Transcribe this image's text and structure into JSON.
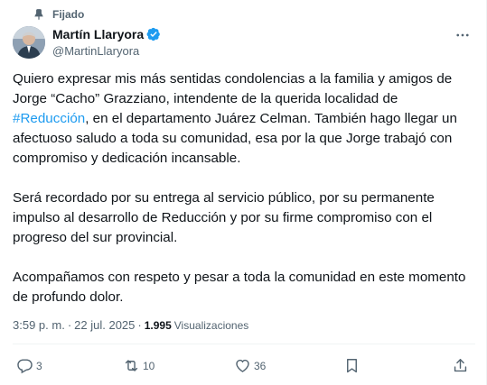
{
  "pinned": {
    "label": "Fijado"
  },
  "author": {
    "name": "Martín Llaryora",
    "handle": "@MartinLlaryora"
  },
  "post": {
    "p1_a": "Quiero expresar mis más sentidas condolencias a la familia y amigos de Jorge “Cacho” Grazziano, intendente de la querida localidad de ",
    "p1_hashtag": "#Reducción",
    "p1_b": ", en el departamento Juárez Celman. También hago llegar un afectuoso saludo a toda su comunidad, esa por la que Jorge trabajó con compromiso y dedicación incansable.",
    "p2": "Será recordado por su entrega al servicio público, por su permanente impulso al desarrollo de Reducción y por su firme compromiso con el progreso del sur provincial.",
    "p3": "Acompañamos con respeto y pesar a toda la comunidad en este momento de profundo dolor."
  },
  "meta": {
    "time": "3:59 p. m.",
    "separator": "·",
    "date": "22 jul. 2025",
    "views_count": "1.995",
    "views_label": "Visualizaciones"
  },
  "actions": {
    "replies": "3",
    "reposts": "10",
    "likes": "36"
  },
  "colors": {
    "accent": "#1d9bf0",
    "text": "#0f1419",
    "secondary": "#536471"
  },
  "icons": [
    "pin-icon",
    "verified-badge-icon",
    "more-icon",
    "reply-icon",
    "repost-icon",
    "like-icon",
    "bookmark-icon",
    "share-icon"
  ]
}
